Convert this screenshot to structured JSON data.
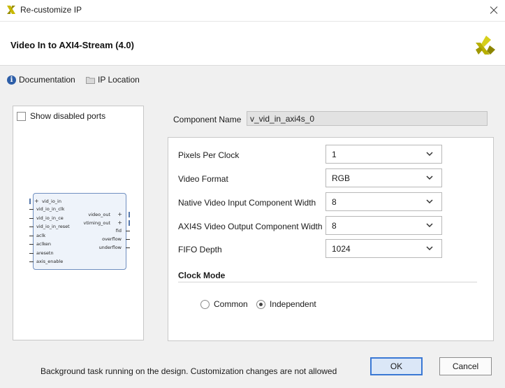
{
  "window": {
    "title": "Re-customize IP",
    "logo_icon": "xilinx-logo-icon",
    "close_icon": "close-icon"
  },
  "header": {
    "title": "Video In to AXI4-Stream (4.0)",
    "brand_color": "#b8b000"
  },
  "links": {
    "documentation": "Documentation",
    "ip_location": "IP Location"
  },
  "symbol": {
    "show_disabled_ports": "Show disabled ports",
    "left_ports": [
      "vid_io_in",
      "vid_io_in_clk",
      "vid_io_in_ce",
      "vid_io_in_reset",
      "aclk",
      "aclken",
      "aresetn",
      "axis_enable"
    ],
    "right_ports": [
      "video_out",
      "vtiming_out",
      "fid",
      "overflow",
      "underflow"
    ]
  },
  "component": {
    "label": "Component Name",
    "value": "v_vid_in_axi4s_0"
  },
  "settings": [
    {
      "label": "Pixels Per Clock",
      "value": "1"
    },
    {
      "label": "Video Format",
      "value": "RGB"
    },
    {
      "label": "Native Video Input Component Width",
      "value": "8"
    },
    {
      "label": "AXI4S Video Output Component Width",
      "value": "8"
    },
    {
      "label": "FIFO Depth",
      "value": "1024"
    }
  ],
  "clock_mode": {
    "title": "Clock Mode",
    "options": [
      "Common",
      "Independent"
    ],
    "selected": "Independent"
  },
  "footer": {
    "status": "Background task running on the design. Customization changes are not allowed",
    "ok": "OK",
    "cancel": "Cancel",
    "accent_color": "#3a78d4"
  }
}
